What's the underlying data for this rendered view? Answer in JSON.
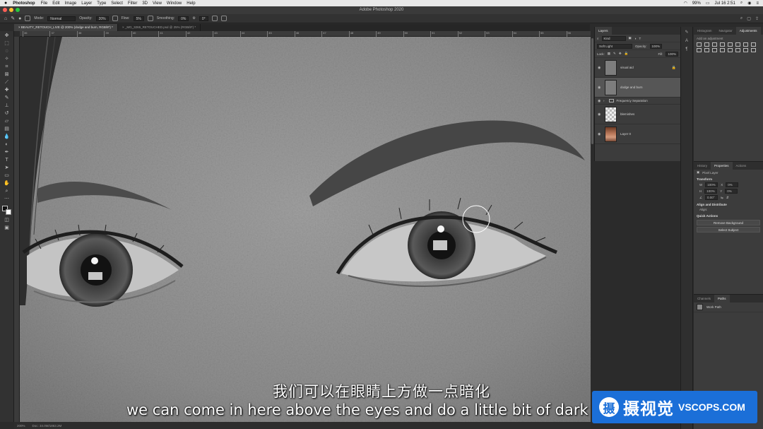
{
  "menubar": {
    "app": "Photoshop",
    "items": [
      "File",
      "Edit",
      "Image",
      "Layer",
      "Type",
      "Select",
      "Filter",
      "3D",
      "View",
      "Window",
      "Help"
    ],
    "battery": "99%",
    "datetime": "Jul 16  2:51"
  },
  "window": {
    "title": "Adobe Photoshop 2020"
  },
  "options": {
    "mode_label": "Mode:",
    "mode_value": "Normal",
    "opacity_label": "Opacity:",
    "opacity_value": "20%",
    "flow_label": "Flow:",
    "flow_value": "5%",
    "smoothing_label": "Smoothing:",
    "smoothing_value": "0%",
    "angle_value": "0°"
  },
  "tabs": [
    {
      "label": "BEAUTY_RETOUCH_LIVE @ 200% (dodge and burn, RGB/8*) *"
    },
    {
      "label": "_MG_3265_RETOUCHED.psd @ 25% (RGB/8*) *"
    }
  ],
  "ruler": {
    "ticks": [
      "36",
      "37",
      "38",
      "39",
      "40",
      "41",
      "42",
      "43",
      "44",
      "45",
      "46",
      "47",
      "48",
      "49",
      "50",
      "51",
      "52",
      "53",
      "54",
      "55",
      "56"
    ]
  },
  "status": {
    "zoom": "200%",
    "doc": "Doc: 34.0M/1863.2M"
  },
  "layers_panel": {
    "tab": "Layers",
    "kind": "Kind",
    "blend": "Soft Light",
    "opacity_label": "Opacity:",
    "opacity_value": "100%",
    "lock_label": "Lock:",
    "fill_label": "Fill:",
    "fill_value": "100%",
    "layers": [
      {
        "name": "visual aid",
        "locked": true
      },
      {
        "name": "dodge and burn",
        "selected": true
      },
      {
        "name": "Frequency Separation",
        "group": true
      },
      {
        "name": "blemishes"
      },
      {
        "name": "Layer 0"
      }
    ]
  },
  "adjust_panel": {
    "tabs": [
      "Histogram",
      "Navigator",
      "Adjustments"
    ],
    "subtitle": "Add an adjustment"
  },
  "props_panel": {
    "tabs": [
      "History",
      "Properties",
      "Actions"
    ],
    "type": "Pixel Layer",
    "transform": "Transform",
    "w_label": "W",
    "w_value": "100%",
    "h_label": "H",
    "h_value": "100%",
    "x_label": "X",
    "x_value": "0%",
    "y_label": "Y",
    "y_value": "0%",
    "angle_value": "0.00°",
    "align": "Align and Distribute",
    "align_sub": "Align:",
    "quick": "Quick Actions",
    "remove_bg": "Remove Background",
    "select_subject": "Select Subject"
  },
  "paths_panel": {
    "tabs": [
      "Channels",
      "Paths"
    ],
    "item": "Work Path"
  },
  "subtitles": {
    "cn": "我们可以在眼睛上方做一点暗化",
    "en": "we can come in here above the eyes and do a little bit of dark"
  },
  "watermark": {
    "cn": "摄视觉",
    "en": "VSCOPS.COM",
    "logo_char": "摄"
  },
  "colors": {
    "accent": "#1b6fd8"
  }
}
